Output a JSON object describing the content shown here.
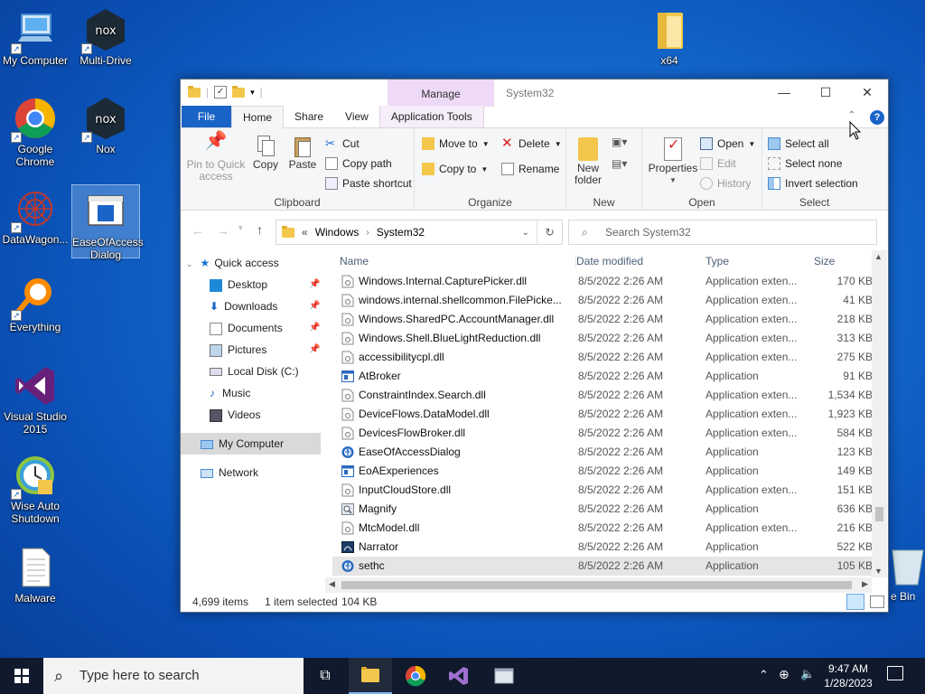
{
  "desktop": {
    "icons": [
      {
        "label": "My Computer"
      },
      {
        "label": "Multi-Drive"
      },
      {
        "label": "x64"
      },
      {
        "label": "Google Chrome"
      },
      {
        "label": "Nox"
      },
      {
        "label": "DataWagon..."
      },
      {
        "label": "EaseOfAccess Dialog"
      },
      {
        "label": "Everything"
      },
      {
        "label": "Visual Studio 2015"
      },
      {
        "label": "Wise Auto Shutdown"
      },
      {
        "label": "Malware"
      }
    ],
    "recycle_label": "e Bin"
  },
  "window": {
    "title": "System32",
    "manage_label": "Manage",
    "tabs": [
      "File",
      "Home",
      "Share",
      "View",
      "Application Tools"
    ],
    "ribbon": {
      "clipboard": {
        "label": "Clipboard",
        "pin": "Pin to Quick access",
        "copy": "Copy",
        "paste": "Paste",
        "cut": "Cut",
        "copy_path": "Copy path",
        "paste_shortcut": "Paste shortcut"
      },
      "organize": {
        "label": "Organize",
        "move_to": "Move to",
        "copy_to": "Copy to",
        "delete": "Delete",
        "rename": "Rename"
      },
      "new": {
        "label": "New",
        "new_folder": "New folder"
      },
      "open": {
        "label": "Open",
        "properties": "Properties",
        "open": "Open",
        "edit": "Edit",
        "history": "History"
      },
      "select": {
        "label": "Select",
        "select_all": "Select all",
        "select_none": "Select none",
        "invert": "Invert selection"
      }
    },
    "address": {
      "crumbs": [
        "Windows",
        "System32"
      ],
      "prefix": "«"
    },
    "search_placeholder": "Search System32",
    "nav_tree": [
      {
        "label": "Quick access",
        "pinned": false
      },
      {
        "label": "Desktop",
        "pinned": true
      },
      {
        "label": "Downloads",
        "pinned": true
      },
      {
        "label": "Documents",
        "pinned": true
      },
      {
        "label": "Pictures",
        "pinned": true
      },
      {
        "label": "Local Disk (C:)",
        "pinned": false
      },
      {
        "label": "Music",
        "pinned": false
      },
      {
        "label": "Videos",
        "pinned": false
      },
      {
        "label": "My Computer",
        "pinned": false
      },
      {
        "label": "Network",
        "pinned": false
      }
    ],
    "columns": {
      "name": "Name",
      "date": "Date modified",
      "type": "Type",
      "size": "Size"
    },
    "files": [
      {
        "name": "Windows.Internal.CapturePicker.dll",
        "date": "8/5/2022 2:26 AM",
        "type": "Application exten...",
        "size": "170 KB",
        "icon": "dll"
      },
      {
        "name": "windows.internal.shellcommon.FilePicke...",
        "date": "8/5/2022 2:26 AM",
        "type": "Application exten...",
        "size": "41 KB",
        "icon": "dll"
      },
      {
        "name": "Windows.SharedPC.AccountManager.dll",
        "date": "8/5/2022 2:26 AM",
        "type": "Application exten...",
        "size": "218 KB",
        "icon": "dll"
      },
      {
        "name": "Windows.Shell.BlueLightReduction.dll",
        "date": "8/5/2022 2:26 AM",
        "type": "Application exten...",
        "size": "313 KB",
        "icon": "dll"
      },
      {
        "name": "accessibilitycpl.dll",
        "date": "8/5/2022 2:26 AM",
        "type": "Application exten...",
        "size": "275 KB",
        "icon": "dll"
      },
      {
        "name": "AtBroker",
        "date": "8/5/2022 2:26 AM",
        "type": "Application",
        "size": "91 KB",
        "icon": "exe"
      },
      {
        "name": "ConstraintIndex.Search.dll",
        "date": "8/5/2022 2:26 AM",
        "type": "Application exten...",
        "size": "1,534 KB",
        "icon": "dll"
      },
      {
        "name": "DeviceFlows.DataModel.dll",
        "date": "8/5/2022 2:26 AM",
        "type": "Application exten...",
        "size": "1,923 KB",
        "icon": "dll"
      },
      {
        "name": "DevicesFlowBroker.dll",
        "date": "8/5/2022 2:26 AM",
        "type": "Application exten...",
        "size": "584 KB",
        "icon": "dll"
      },
      {
        "name": "EaseOfAccessDialog",
        "date": "8/5/2022 2:26 AM",
        "type": "Application",
        "size": "123 KB",
        "icon": "ease"
      },
      {
        "name": "EoAExperiences",
        "date": "8/5/2022 2:26 AM",
        "type": "Application",
        "size": "149 KB",
        "icon": "exe"
      },
      {
        "name": "InputCloudStore.dll",
        "date": "8/5/2022 2:26 AM",
        "type": "Application exten...",
        "size": "151 KB",
        "icon": "dll"
      },
      {
        "name": "Magnify",
        "date": "8/5/2022 2:26 AM",
        "type": "Application",
        "size": "636 KB",
        "icon": "magnify"
      },
      {
        "name": "MtcModel.dll",
        "date": "8/5/2022 2:26 AM",
        "type": "Application exten...",
        "size": "216 KB",
        "icon": "dll"
      },
      {
        "name": "Narrator",
        "date": "8/5/2022 2:26 AM",
        "type": "Application",
        "size": "522 KB",
        "icon": "narrator"
      },
      {
        "name": "sethc",
        "date": "8/5/2022 2:26 AM",
        "type": "Application",
        "size": "105 KB",
        "icon": "ease",
        "selected": true
      }
    ],
    "status": {
      "count": "4,699 items",
      "selection": "1 item selected",
      "size": "104 KB"
    }
  },
  "taskbar": {
    "search_placeholder": "Type here to search",
    "time": "9:47 AM",
    "date": "1/28/2023"
  },
  "colors": {
    "accent": "#1a64c8",
    "manage": "#eed9f6",
    "selection": "#cce8ff"
  }
}
